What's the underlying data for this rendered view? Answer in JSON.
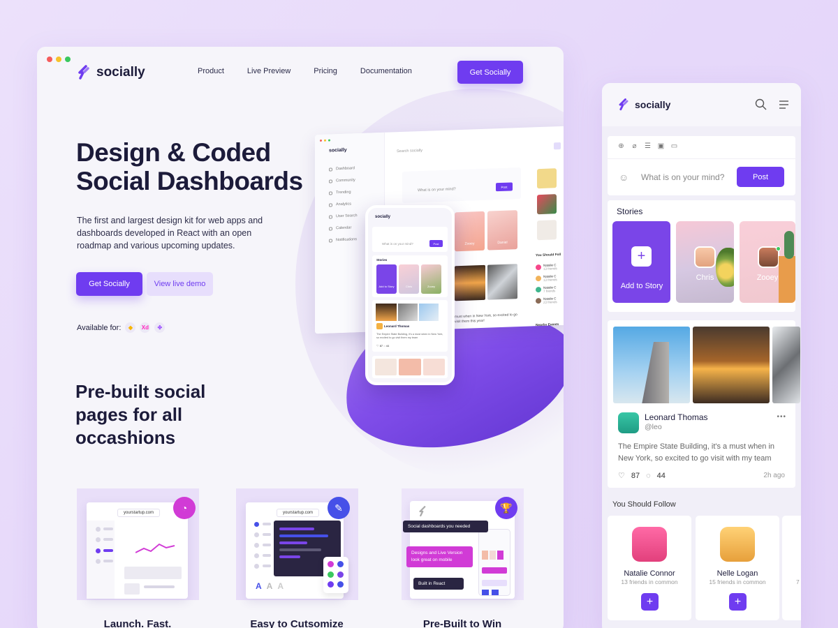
{
  "colors": {
    "accent": "#6f3cf0",
    "accent_soft": "#e7defc",
    "text_dark": "#1c1b3a",
    "background": "#e8dcfa"
  },
  "window_dots": [
    "#f55c5c",
    "#f7c22b",
    "#3ac85e"
  ],
  "brand": {
    "name": "socially",
    "icon": "socially-logo-icon"
  },
  "nav": {
    "items": [
      "Product",
      "Live Preview",
      "Pricing",
      "Documentation"
    ],
    "cta": "Get Socially"
  },
  "hero": {
    "title_line1": "Design & Coded",
    "title_line2": "Social Dashboards",
    "description": "The first and largest design kit for web apps and dashboards developed in React with an open roadmap and various upcoming updates.",
    "primary_button": "Get Socially",
    "secondary_button": "View live demo",
    "available_label": "Available for:",
    "tools": [
      {
        "label": "",
        "icon": "sketch-icon",
        "color": "#f7b500"
      },
      {
        "label": "Xd",
        "icon": "xd-icon",
        "color": "#ff26be"
      },
      {
        "label": "",
        "icon": "figma-icon",
        "color": "#a259ff"
      }
    ]
  },
  "mock_dashboard": {
    "brand": "socially",
    "search_placeholder": "Search socially",
    "sidebar": [
      "Dashboard",
      "Community",
      "Trending",
      "Analytics",
      "User Search",
      "Calendar",
      "Notifications"
    ],
    "composer_placeholder": "What is on your mind?",
    "post_label": "Post",
    "you_should_follow": "You Should Foll",
    "follow_items": [
      {
        "name": "Natalie C",
        "sub": "13 friends"
      },
      {
        "name": "Natalie C",
        "sub": "13 friends"
      },
      {
        "name": "Natalie C",
        "sub": "7 friends"
      },
      {
        "name": "Natalie C",
        "sub": "23 friends"
      }
    ],
    "nearby_events": "Nearby Events",
    "story_names": [
      "Zooey",
      "Daniel"
    ],
    "post_text": "must when in New York, so excited to go visit them this year!"
  },
  "mock_phone": {
    "brand": "socially",
    "composer_placeholder": "What is on your mind?",
    "post_label": "Post",
    "stories_label": "Stories",
    "stories": [
      "Add to Story",
      "Chris",
      "Zooey"
    ],
    "author": "Leonard Thomas",
    "handle": "@leo",
    "post_text": "The Empire State Building, it's a must when in New York, so excited to go visit them my team",
    "likes": "87",
    "comments": "44",
    "time": "2h ago"
  },
  "section": {
    "title": "Pre-built social pages for all occashions"
  },
  "features": [
    {
      "title": "Launch. Fast.",
      "url": "yourstartup.com",
      "badge_icon": "speedometer-icon",
      "badge_color": "#d13bd6"
    },
    {
      "title": "Easy to Cutsomize",
      "url": "yourstartup.com",
      "badge_icon": "paint-bucket-icon",
      "badge_color": "#4650e8",
      "fonts": [
        "A",
        "A",
        "A"
      ]
    },
    {
      "title": "Pre-Built to Win",
      "badge_icon": "trophy-icon",
      "badge_color": "#6f3cf0",
      "chips": [
        "Social dashboards you needed",
        "Designs and Live Version look great on mobile",
        "Built in React"
      ]
    }
  ],
  "mobile": {
    "brand": "socially",
    "composer_placeholder": "What is on your mind?",
    "post_label": "Post",
    "stories_label": "Stories",
    "stories": [
      {
        "label": "Add to Story",
        "plus": "+"
      },
      {
        "label": "Chris"
      },
      {
        "label": "Zooey"
      }
    ],
    "post": {
      "author": "Leonard Thomas",
      "handle": "@leo",
      "text": "The Empire State Building, it's a must when in New York, so excited to go visit with my team",
      "likes": "87",
      "comments": "44",
      "time": "2h ago",
      "more": "•••"
    },
    "follow_label": "You Should Follow",
    "follow": [
      {
        "name": "Natalie Connor",
        "sub": "13 friends in common"
      },
      {
        "name": "Nelle Logan",
        "sub": "15 friends in common"
      },
      {
        "name": "",
        "sub": "7"
      }
    ],
    "plus": "+"
  }
}
